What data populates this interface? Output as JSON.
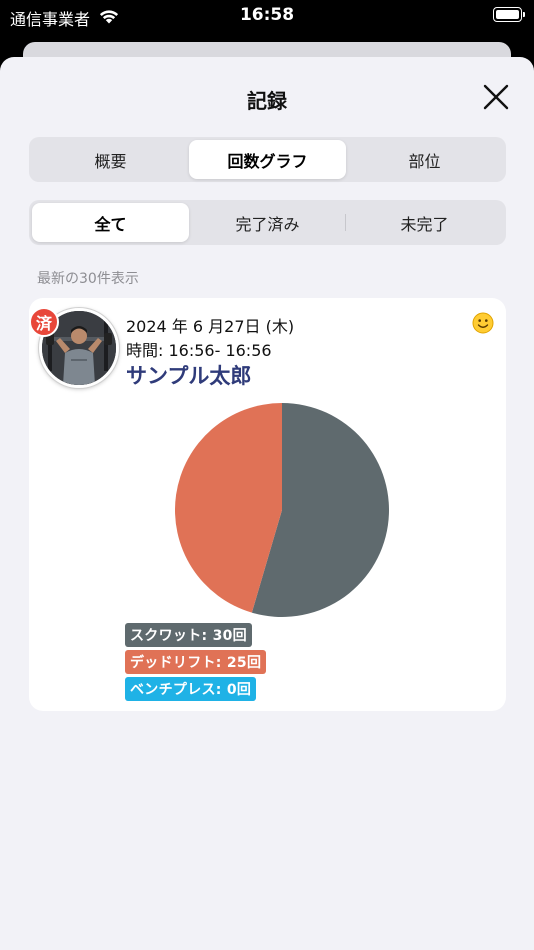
{
  "status_bar": {
    "carrier": "通信事業者",
    "time": "16:58"
  },
  "sheet": {
    "title": "記録"
  },
  "tabs_primary": [
    {
      "label": "概要",
      "active": false
    },
    {
      "label": "回数グラフ",
      "active": true
    },
    {
      "label": "部位",
      "active": false
    }
  ],
  "tabs_filter": [
    {
      "label": "全て",
      "active": true
    },
    {
      "label": "完了済み",
      "active": false
    },
    {
      "label": "未完了",
      "active": false
    }
  ],
  "section_note": "最新の30件表示",
  "record": {
    "done_badge": "済",
    "date": "2024 年 6 月27日 (木)",
    "time": "時間: 16:56-   16:56",
    "name": "サンプル太郎",
    "mood_icon": "smiley-face-icon"
  },
  "chart_data": {
    "type": "pie",
    "series": [
      {
        "name": "スクワット",
        "value": 30,
        "color": "#5f6a6e",
        "label": "スクワット: 30回"
      },
      {
        "name": "デッドリフト",
        "value": 25,
        "color": "#e07256",
        "label": "デッドリフト: 25回"
      },
      {
        "name": "ベンチプレス",
        "value": 0,
        "color": "#1fb2e6",
        "label": "ベンチプレス: 0回"
      }
    ]
  }
}
